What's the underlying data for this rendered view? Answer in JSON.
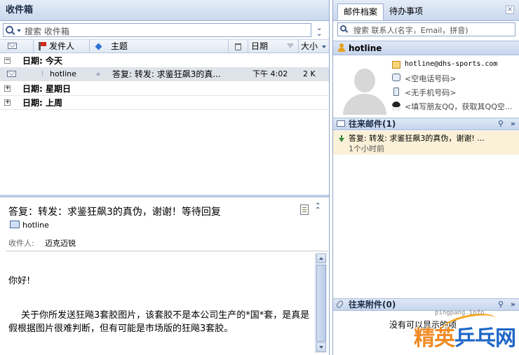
{
  "inbox": {
    "title": "收件箱",
    "search_placeholder": "搜索 收件箱",
    "columns": {
      "sender": "发件人",
      "subject": "主题",
      "date": "日期",
      "size": "大小"
    },
    "groups": [
      {
        "label": "日期: 今天",
        "expander": "−"
      },
      {
        "label": "日期: 星期日",
        "expander": "+"
      },
      {
        "label": "日期: 上周",
        "expander": "+"
      }
    ],
    "message": {
      "sender": "hotline",
      "subject": "答复: 转发: 求鉴狂飙3的真...",
      "time": "下午 4:02",
      "size": "2 K"
    }
  },
  "preview": {
    "subject": "答复：转发：求鉴狂飙3的真伪，谢谢！等待回复",
    "sender": "hotline",
    "recipient_label": "收件人:",
    "recipient": "迈克迈锐",
    "greeting": "你好!",
    "body": "关于你所发送狂飚3套胶图片，该套胶不是本公司生产的*国*套，是真是假根据图片很难判断，但有可能是市场版的狂飚3套胶。"
  },
  "contact_panel": {
    "tabs": [
      "邮件档案",
      "待办事项"
    ],
    "close": "×",
    "search_placeholder": "搜索 联系人(名字，Email，拼音)",
    "name": "hotline",
    "email": "hotline@dhs-sports.com",
    "phone": "<空电话号码>",
    "mobile": "<无手机号码>",
    "qq": "<填写朋友QQ，获取其QQ空...",
    "mail_section": "往来邮件(1)",
    "mail_items": [
      {
        "subject": "答复: 转发: 求鉴狂飙3的真伪，谢谢! ...",
        "time": "1个小时前"
      }
    ],
    "attach_section": "往来附件(0)",
    "attach_empty": "没有可以显示的项"
  },
  "watermark": {
    "url": "pingpang.info",
    "brand_a": "精英",
    "brand_b": "乒乓网"
  },
  "colors": {
    "header_gradient_top": "#e4ecf8",
    "header_gradient_bottom": "#c9d8ee",
    "selected_row": "#dfe3ea",
    "thread_highlight": "#fbf1d8",
    "watermark_orange": "#f08a24",
    "watermark_blue": "#1e66c7"
  }
}
